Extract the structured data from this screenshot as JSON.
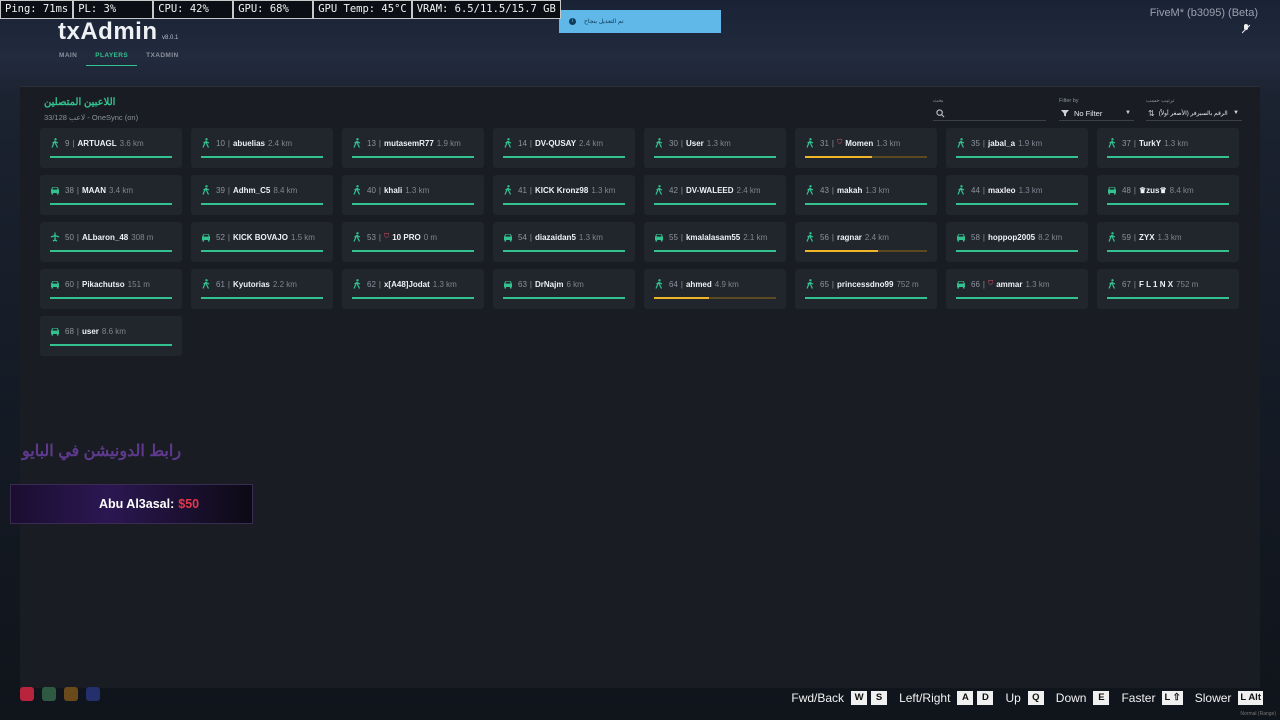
{
  "stats": {
    "ping": "Ping: 71ms",
    "pl": "PL: 3%",
    "cpu": "CPU: 42%",
    "gpu": "GPU: 68%",
    "gpu_temp": "GPU Temp: 45°C",
    "vram": "VRAM: 6.5/11.5/15.7 GB"
  },
  "fivem_label": "FiveM* (b3095) (Beta)",
  "toast": {
    "text": "تم التعديل بنجاح"
  },
  "brand": {
    "name": "txAdmin",
    "version": "v8.0.1"
  },
  "nav": {
    "main": "MAIN",
    "players": "PLAYERS",
    "txadmin": "TXADMIN"
  },
  "header": {
    "title": "اللاعبين المتصلين",
    "subtitle": "33/128 لاعب - OneSync (on)"
  },
  "controls": {
    "search_label": "بحث",
    "search_placeholder": "",
    "filter_label": "Filter by",
    "filter_value": "No Filter",
    "sort_label": "ترتيب حسب",
    "sort_value": "الرقم بالسيرفر (الأصغر أولاً)"
  },
  "players": [
    {
      "id": "9",
      "name": "ARTUAGL",
      "dist": "3.6 km",
      "mode": "walk",
      "health": 1.0,
      "admin": false
    },
    {
      "id": "10",
      "name": "abuelias",
      "dist": "2.4 km",
      "mode": "walk",
      "health": 1.0,
      "admin": false
    },
    {
      "id": "13",
      "name": "mutasemR77",
      "dist": "1.9 km",
      "mode": "walk",
      "health": 1.0,
      "admin": false
    },
    {
      "id": "14",
      "name": "DV-QUSAY",
      "dist": "2.4 km",
      "mode": "walk",
      "health": 1.0,
      "admin": false
    },
    {
      "id": "30",
      "name": "User",
      "dist": "1.3 km",
      "mode": "walk",
      "health": 1.0,
      "admin": false
    },
    {
      "id": "31",
      "name": "Momen",
      "dist": "1.3 km",
      "mode": "walk",
      "health": 0.55,
      "admin": true
    },
    {
      "id": "35",
      "name": "jabal_a",
      "dist": "1.9 km",
      "mode": "walk",
      "health": 1.0,
      "admin": false
    },
    {
      "id": "37",
      "name": "TurkY",
      "dist": "1.3 km",
      "mode": "walk",
      "health": 1.0,
      "admin": false
    },
    {
      "id": "38",
      "name": "MAAN",
      "dist": "3.4 km",
      "mode": "car",
      "health": 1.0,
      "admin": false
    },
    {
      "id": "39",
      "name": "Adhm_C5",
      "dist": "8.4 km",
      "mode": "walk",
      "health": 1.0,
      "admin": false
    },
    {
      "id": "40",
      "name": "khali",
      "dist": "1.3 km",
      "mode": "walk",
      "health": 1.0,
      "admin": false
    },
    {
      "id": "41",
      "name": "KICK Kronz98",
      "dist": "1.3 km",
      "mode": "walk",
      "health": 1.0,
      "admin": false
    },
    {
      "id": "42",
      "name": "DV-WALEED",
      "dist": "2.4 km",
      "mode": "walk",
      "health": 1.0,
      "admin": false
    },
    {
      "id": "43",
      "name": "makah",
      "dist": "1.3 km",
      "mode": "walk",
      "health": 1.0,
      "admin": false
    },
    {
      "id": "44",
      "name": "maxleo",
      "dist": "1.3 km",
      "mode": "walk",
      "health": 1.0,
      "admin": false
    },
    {
      "id": "48",
      "name": "♛zus♛",
      "dist": "8.4 km",
      "mode": "car",
      "health": 1.0,
      "admin": false
    },
    {
      "id": "50",
      "name": "ALbaron_48",
      "dist": "308 m",
      "mode": "plane",
      "health": 1.0,
      "admin": false
    },
    {
      "id": "52",
      "name": "KICK BOVAJO",
      "dist": "1.5 km",
      "mode": "car",
      "health": 1.0,
      "admin": false
    },
    {
      "id": "53",
      "name": "10 PRO",
      "dist": "0 m",
      "mode": "walk",
      "health": 1.0,
      "admin": true
    },
    {
      "id": "54",
      "name": "diazaidan5",
      "dist": "1.3 km",
      "mode": "car",
      "health": 1.0,
      "admin": false
    },
    {
      "id": "55",
      "name": "kmalalasam55",
      "dist": "2.1 km",
      "mode": "car",
      "health": 1.0,
      "admin": false
    },
    {
      "id": "56",
      "name": "ragnar",
      "dist": "2.4 km",
      "mode": "walk",
      "health": 0.6,
      "admin": false
    },
    {
      "id": "58",
      "name": "hoppop2005",
      "dist": "8.2 km",
      "mode": "car",
      "health": 1.0,
      "admin": false
    },
    {
      "id": "59",
      "name": "ZYX",
      "dist": "1.3 km",
      "mode": "walk",
      "health": 1.0,
      "admin": false
    },
    {
      "id": "60",
      "name": "Pikachutso",
      "dist": "151 m",
      "mode": "car",
      "health": 1.0,
      "admin": false
    },
    {
      "id": "61",
      "name": "Kyutorias",
      "dist": "2.2 km",
      "mode": "walk",
      "health": 1.0,
      "admin": false
    },
    {
      "id": "62",
      "name": "x[A48]Jodat",
      "dist": "1.3 km",
      "mode": "walk",
      "health": 1.0,
      "admin": false
    },
    {
      "id": "63",
      "name": "DrNajm",
      "dist": "6 km",
      "mode": "car",
      "health": 1.0,
      "admin": false
    },
    {
      "id": "64",
      "name": "ahmed",
      "dist": "4.9 km",
      "mode": "walk",
      "health": 0.45,
      "admin": false
    },
    {
      "id": "65",
      "name": "princessdno99",
      "dist": "752 m",
      "mode": "walk",
      "health": 1.0,
      "admin": false
    },
    {
      "id": "66",
      "name": "ammar",
      "dist": "1.3 km",
      "mode": "car",
      "health": 1.0,
      "admin": true
    },
    {
      "id": "67",
      "name": "F L 1 N X",
      "dist": "752 m",
      "mode": "walk",
      "health": 1.0,
      "admin": false
    },
    {
      "id": "68",
      "name": "user",
      "dist": "8.6 km",
      "mode": "car",
      "health": 1.0,
      "admin": false
    }
  ],
  "overlay": {
    "stream_text": "رابط الدونيشن في البايو",
    "donor": "Abu Al3asal:",
    "amount": "$50"
  },
  "keys": [
    {
      "label": "Fwd/Back",
      "keys": [
        "W",
        "S"
      ]
    },
    {
      "label": "Left/Right",
      "keys": [
        "A",
        "D"
      ]
    },
    {
      "label": "Up",
      "keys": [
        "Q"
      ]
    },
    {
      "label": "Down",
      "keys": [
        "E"
      ]
    },
    {
      "label": "Faster",
      "keys": [
        "L ⇧"
      ]
    },
    {
      "label": "Slower",
      "keys": [
        "L Alt"
      ]
    }
  ],
  "normal_label": "Normal (Range)",
  "colors": {
    "accent": "#33c28f",
    "warn": "#f0b429",
    "admin": "#e0506a"
  }
}
